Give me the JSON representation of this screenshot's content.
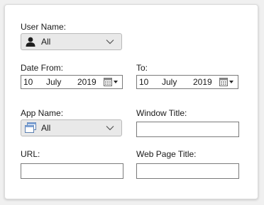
{
  "filters": {
    "user_name": {
      "label": "User Name:",
      "value": "All",
      "icon": "user-icon"
    },
    "date_from": {
      "label": "Date From:",
      "day": "10",
      "month": "July",
      "year": "2019",
      "icon": "calendar-icon"
    },
    "date_to": {
      "label": "To:",
      "day": "10",
      "month": "July",
      "year": "2019",
      "icon": "calendar-icon"
    },
    "app_name": {
      "label": "App Name:",
      "value": "All",
      "icon": "window-icon"
    },
    "window_title": {
      "label": "Window Title:",
      "value": ""
    },
    "url": {
      "label": "URL:",
      "value": ""
    },
    "web_page_title": {
      "label": "Web Page Title:",
      "value": ""
    }
  }
}
